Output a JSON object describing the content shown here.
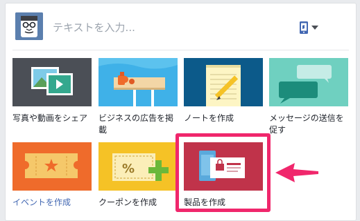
{
  "composer": {
    "placeholder": "テキストを入力...",
    "avatar_icon": "illustrated-face-avatar",
    "audience_icon": "phone-icon",
    "audience_dropdown_icon": "caret-down-icon"
  },
  "actions": [
    {
      "label": "写真や動画をシェア",
      "icon": "photo-video-icon",
      "color": "#4b4f56"
    },
    {
      "label": "ビジネスの広告を掲載",
      "icon": "billboard-icon",
      "color": "#3fb1e8"
    },
    {
      "label": "ノートを作成",
      "icon": "notepad-pencil-icon",
      "color": "#0c5a8a"
    },
    {
      "label": "メッセージの送信を促す",
      "icon": "chat-bubbles-icon",
      "color": "#6fd0c0"
    },
    {
      "label": "イベントを作成",
      "icon": "ticket-icon",
      "color": "#ef6b2b"
    },
    {
      "label": "クーポンを作成",
      "icon": "coupon-icon",
      "color": "#f5c226"
    },
    {
      "label": "製品を作成",
      "icon": "product-card-icon",
      "color": "#c0334a"
    }
  ],
  "colors": {
    "link": "#4267b2",
    "highlight": "#f0276c",
    "text": "#1d2129",
    "placeholder": "#9ba3ad"
  }
}
